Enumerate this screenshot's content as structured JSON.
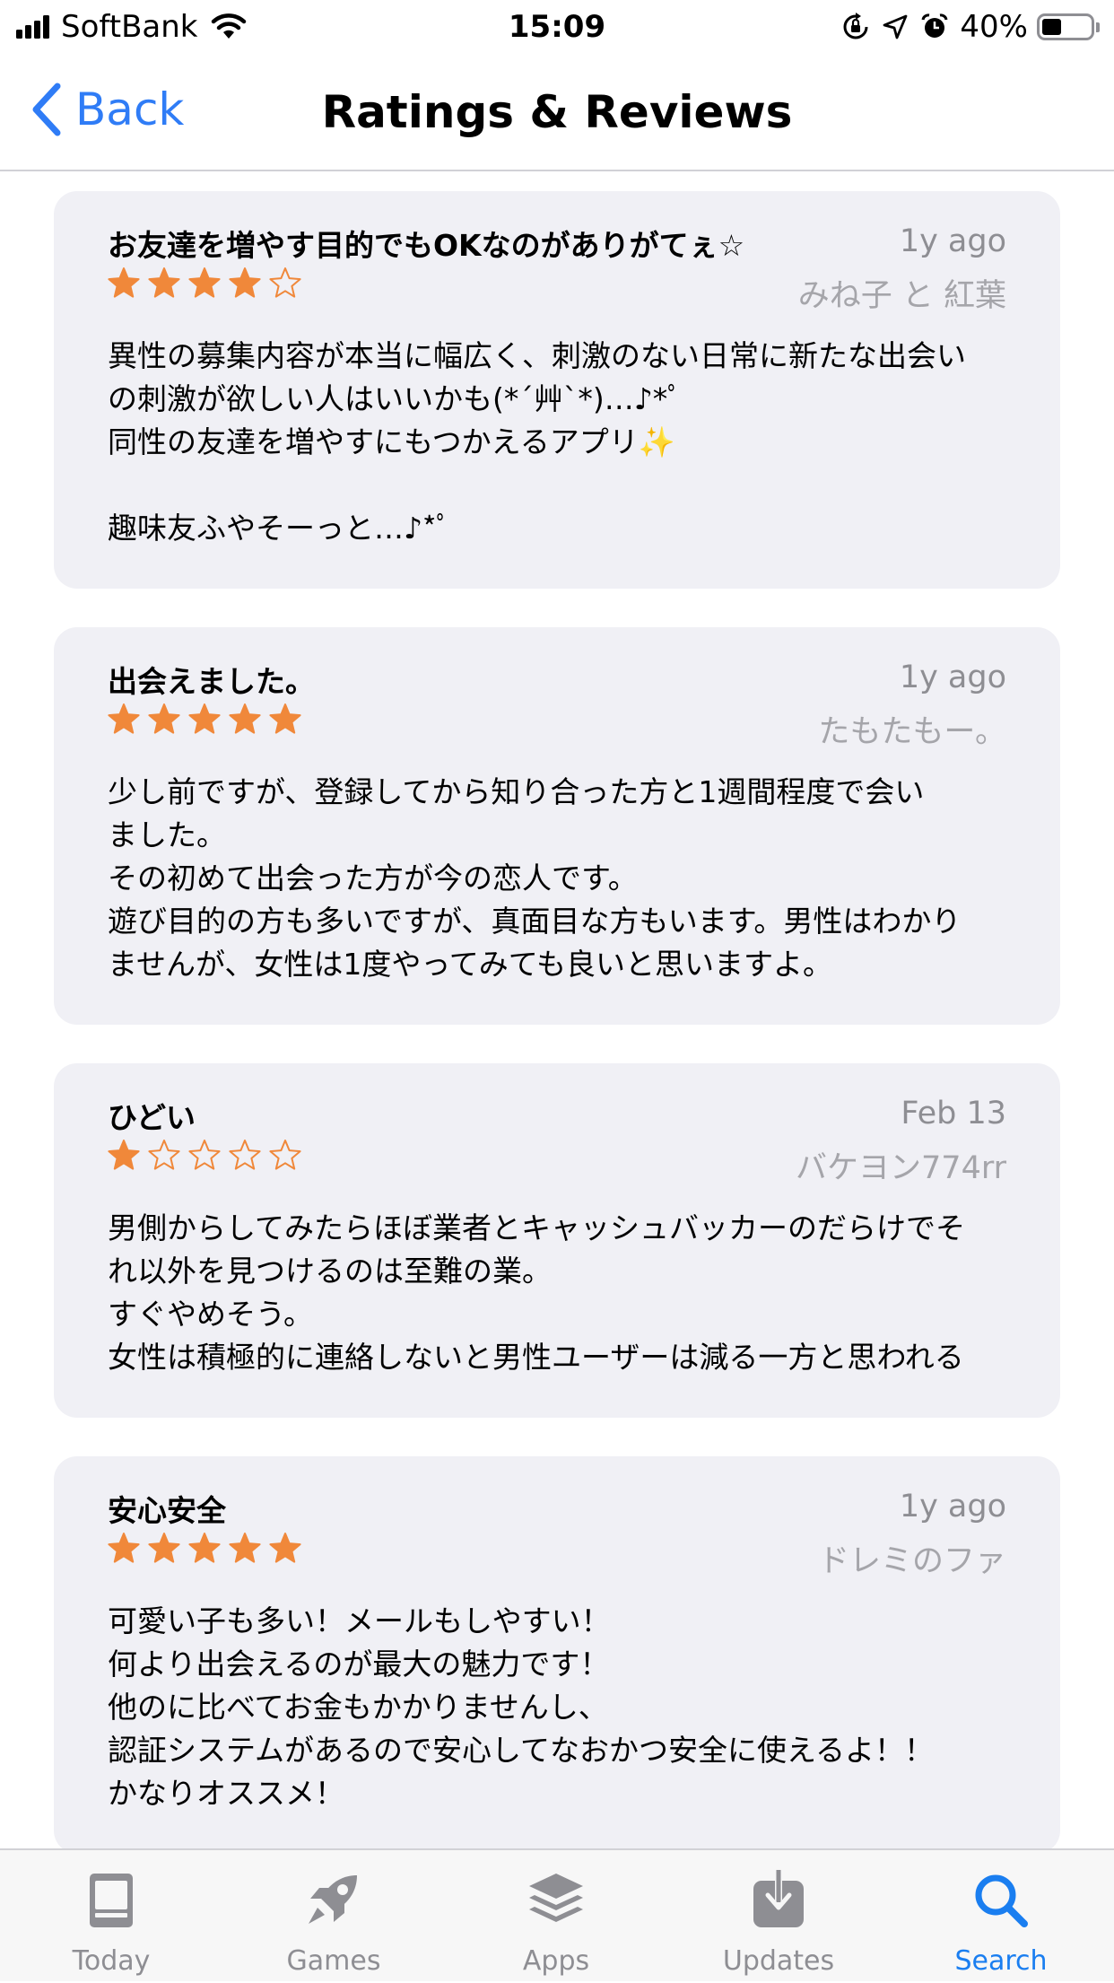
{
  "status_bar": {
    "carrier": "SoftBank",
    "time": "15:09",
    "battery_percent": "40%",
    "battery_level": 0.4
  },
  "nav": {
    "back_label": "Back",
    "title": "Ratings & Reviews"
  },
  "reviews": [
    {
      "title": "お友達を増やす目的でもOKなのがありがてぇ☆",
      "date": "1y ago",
      "author": "みね子 と 紅葉",
      "rating": 4,
      "body": "異性の募集内容が本当に幅広く、刺激のない日常に新たな出会い\nの刺激が欲しい人はいいかも(*´艸`*)…♪*ﾟ\n同性の友達を増やすにもつかえるアプリ✨\n\n趣味友ふやそーっと…♪*ﾟ"
    },
    {
      "title": "出会えました。",
      "date": "1y ago",
      "author": "たもたもー。",
      "rating": 5,
      "body": "少し前ですが、登録してから知り合った方と1週間程度で会い\nました。\nその初めて出会った方が今の恋人です。\n遊び目的の方も多いですが、真面目な方もいます。男性はわかり\nませんが、女性は1度やってみても良いと思いますよ。"
    },
    {
      "title": "ひどい",
      "date": "Feb 13",
      "author": "バケヨン774rr",
      "rating": 1,
      "body": "男側からしてみたらほぼ業者とキャッシュバッカーのだらけでそ\nれ以外を見つけるのは至難の業。\nすぐやめそう。\n女性は積極的に連絡しないと男性ユーザーは減る一方と思われる"
    },
    {
      "title": "安心安全",
      "date": "1y ago",
      "author": "ドレミのファ",
      "rating": 5,
      "body": "可愛い子も多い！メールもしやすい！\n何より出会えるのが最大の魅力です！\n他のに比べてお金もかかりませんし、\n認証システムがあるので安心してなおかつ安全に使えるよ！！\nかなりオススメ！"
    }
  ],
  "tabs": [
    {
      "label": "Today",
      "icon": "today-icon",
      "active": false
    },
    {
      "label": "Games",
      "icon": "rocket-icon",
      "active": false
    },
    {
      "label": "Apps",
      "icon": "layers-icon",
      "active": false
    },
    {
      "label": "Updates",
      "icon": "download-icon",
      "active": false
    },
    {
      "label": "Search",
      "icon": "search-icon",
      "active": true
    }
  ],
  "colors": {
    "accent": "#2f7cf6",
    "star": "#f0883a",
    "card_background": "#f0f0f5",
    "inactive_tab": "#8e8e93"
  }
}
